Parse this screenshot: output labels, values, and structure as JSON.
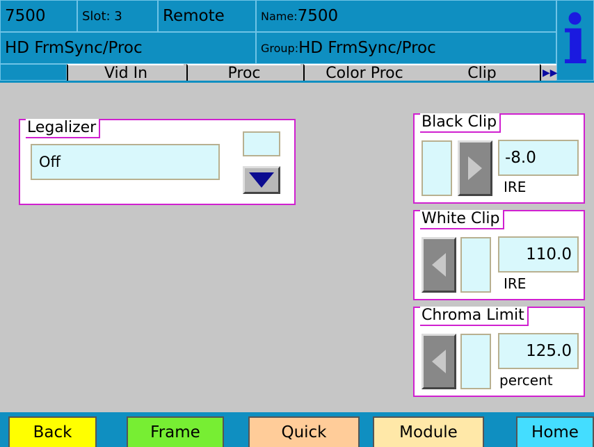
{
  "header": {
    "model": "7500",
    "slot_label": "Slot: 3",
    "mode": "Remote",
    "name_label": "Name:",
    "name_value": "7500",
    "product": "HD FrmSync/Proc",
    "group_label": "Group:",
    "group_value": "HD FrmSync/Proc",
    "info_glyph": "i"
  },
  "tabs": [
    {
      "label": "Vid In"
    },
    {
      "label": "Proc"
    },
    {
      "label": "Color Proc"
    },
    {
      "label": "Clip",
      "active": true
    }
  ],
  "tab_next_icon": "double-right-arrow-icon",
  "legalizer": {
    "title": "Legalizer",
    "value": "Off"
  },
  "black_clip": {
    "title": "Black Clip",
    "value": "-8.0",
    "unit": "IRE"
  },
  "white_clip": {
    "title": "White Clip",
    "value": "110.0",
    "unit": "IRE"
  },
  "chroma_limit": {
    "title": "Chroma Limit",
    "value": "125.0",
    "unit": "percent"
  },
  "nav": {
    "back": "Back",
    "frame": "Frame",
    "quick": "Quick",
    "module": "Module",
    "home": "Home"
  },
  "colors": {
    "header_blue": "#0f8fc1",
    "group_border": "#d020d0",
    "field_bg": "#d9f8fc",
    "back_btn": "#ffff00",
    "frame_btn": "#77ee33",
    "quick_btn": "#ffcc99",
    "module_btn": "#ffe8a8",
    "home_btn": "#44ddff"
  }
}
